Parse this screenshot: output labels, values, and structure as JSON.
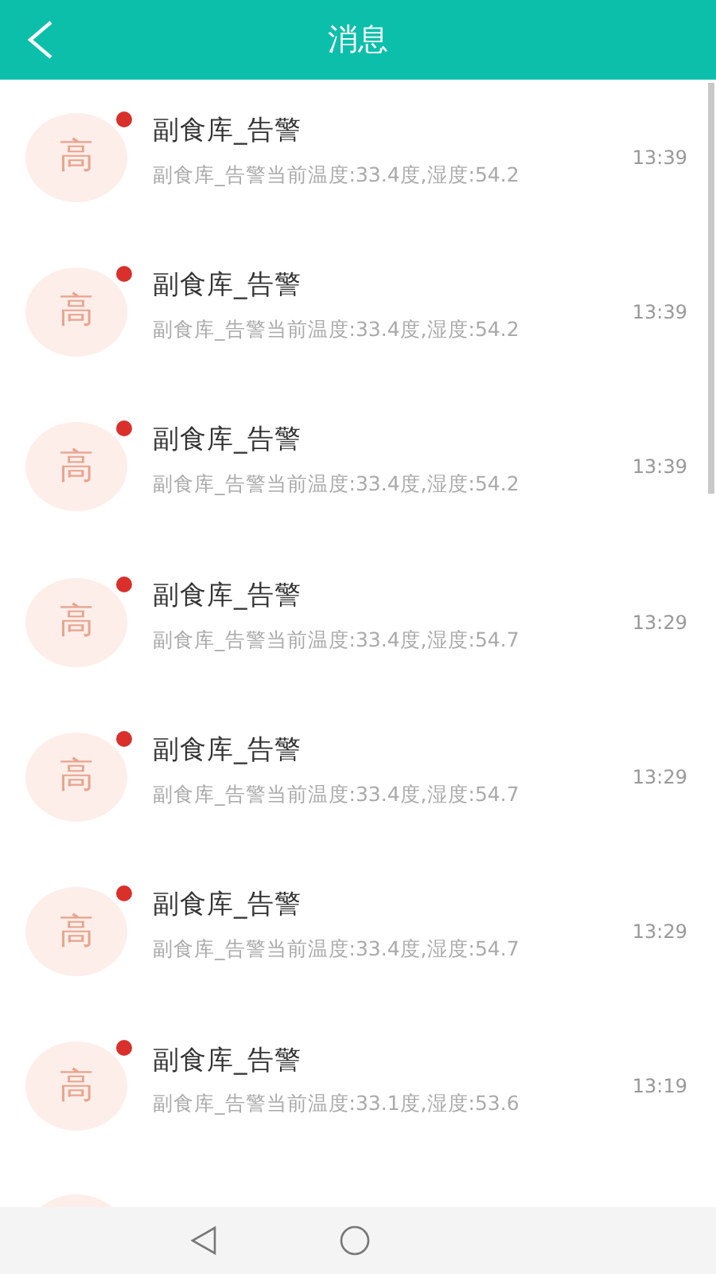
{
  "header": {
    "title": "消息"
  },
  "messages": [
    {
      "badge": "高",
      "unread": true,
      "title": "副食库_告警",
      "body": "副食库_告警当前温度:33.4度,湿度:54.2",
      "time": "13:39"
    },
    {
      "badge": "高",
      "unread": true,
      "title": "副食库_告警",
      "body": "副食库_告警当前温度:33.4度,湿度:54.2",
      "time": "13:39"
    },
    {
      "badge": "高",
      "unread": true,
      "title": "副食库_告警",
      "body": "副食库_告警当前温度:33.4度,湿度:54.2",
      "time": "13:39"
    },
    {
      "badge": "高",
      "unread": true,
      "title": "副食库_告警",
      "body": "副食库_告警当前温度:33.4度,湿度:54.7",
      "time": "13:29"
    },
    {
      "badge": "高",
      "unread": true,
      "title": "副食库_告警",
      "body": "副食库_告警当前温度:33.4度,湿度:54.7",
      "time": "13:29"
    },
    {
      "badge": "高",
      "unread": true,
      "title": "副食库_告警",
      "body": "副食库_告警当前温度:33.4度,湿度:54.7",
      "time": "13:29"
    },
    {
      "badge": "高",
      "unread": true,
      "title": "副食库_告警",
      "body": "副食库_告警当前温度:33.1度,湿度:53.6",
      "time": "13:19"
    }
  ]
}
